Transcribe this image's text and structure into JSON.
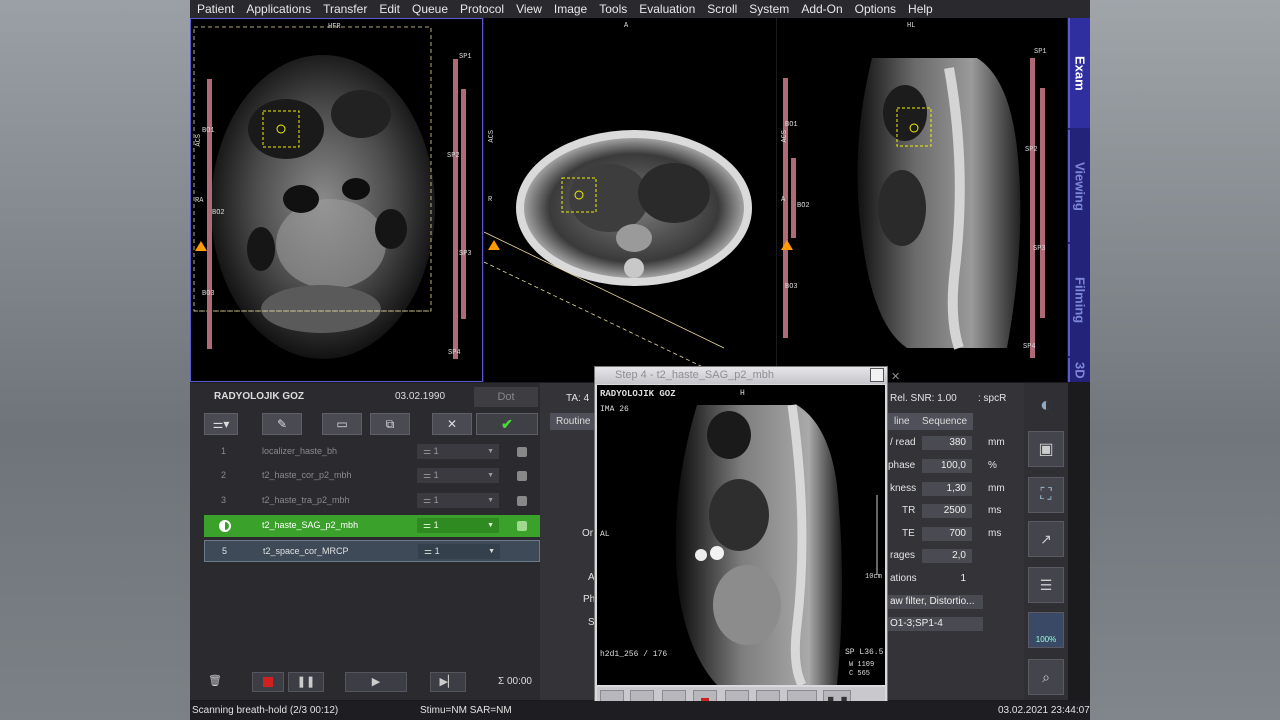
{
  "menu": [
    "Patient",
    "Applications",
    "Transfer",
    "Edit",
    "Queue",
    "Protocol",
    "View",
    "Image",
    "Tools",
    "Evaluation",
    "Scroll",
    "System",
    "Add-On",
    "Options",
    "Help"
  ],
  "viewports": {
    "cor": {
      "top": "HFR",
      "left_orient": "ACS",
      "left_side": "RA",
      "markers": [
        "BO1",
        "BO2",
        "BO3"
      ],
      "right_markers": [
        "SP1",
        "SP2",
        "SP3",
        "SP4"
      ]
    },
    "tra": {
      "top": "A",
      "left_orient": "ACS",
      "left_side": "R"
    },
    "sag": {
      "top": "HL",
      "left_orient": "ACS",
      "left_side": "A",
      "markers": [
        "BO1",
        "BO2",
        "BO3"
      ],
      "right_markers": [
        "SP1",
        "SP2",
        "SP3",
        "SP4"
      ]
    }
  },
  "side_tabs": [
    "Exam",
    "Viewing",
    "Filming",
    "3D"
  ],
  "patient": {
    "name": "RADYOLOJIK GOZ",
    "dob": "03.02.1990",
    "dot": "Dot",
    "ta": "TA: 4"
  },
  "queue": [
    {
      "num": "1",
      "name": "localizer_haste_bh",
      "count": "1"
    },
    {
      "num": "2",
      "name": "t2_haste_cor_p2_mbh",
      "count": "1"
    },
    {
      "num": "3",
      "name": "t2_haste_tra_p2_mbh",
      "count": "1"
    },
    {
      "num": "",
      "name": "t2_haste_SAG_p2_mbh",
      "count": "1"
    },
    {
      "num": "5",
      "name": "t2_space_cor_MRCP",
      "count": "1"
    }
  ],
  "sum_time": "Σ 00:00",
  "params": {
    "rel_snr": "Rel. SNR: 1.00",
    "spc": ": spcR",
    "tab_routine": "Routine",
    "tab_line": "line",
    "tab_sequence": "Sequence",
    "rows": [
      {
        "label": "/ read",
        "value": "380",
        "unit": "mm"
      },
      {
        "label": "phase",
        "value": "100,0",
        "unit": "%"
      },
      {
        "label": "kness",
        "value": "1,30",
        "unit": "mm"
      },
      {
        "label": "TR",
        "value": "2500",
        "unit": "ms"
      },
      {
        "label": "TE",
        "value": "700",
        "unit": "ms"
      },
      {
        "label": "rages",
        "value": "2,0",
        "unit": ""
      },
      {
        "label": "ations",
        "value": "1",
        "unit": ""
      }
    ],
    "filter": "aw filter, Distortio...",
    "coils": "O1-3;SP1-4",
    "left_labels": [
      "Or",
      "A",
      "Ph",
      "S"
    ]
  },
  "dialog": {
    "title": "Step 4 - t2_haste_SAG_p2_mbh",
    "patient": "RADYOLOJIK GOZ",
    "ima": "IMA 26",
    "top": "H",
    "left": "AL",
    "seq": "h2d1_256 / 176",
    "sp": "SP L36.5",
    "w": "W 1109",
    "c": "C 565",
    "scale": "10cm"
  },
  "status": {
    "left": "Scanning breath-hold  (2/3 00:12)",
    "mid": "Stimu=NM SAR=NM",
    "date": "03.02.2021 23:44:07"
  },
  "side_zoom": "100%"
}
